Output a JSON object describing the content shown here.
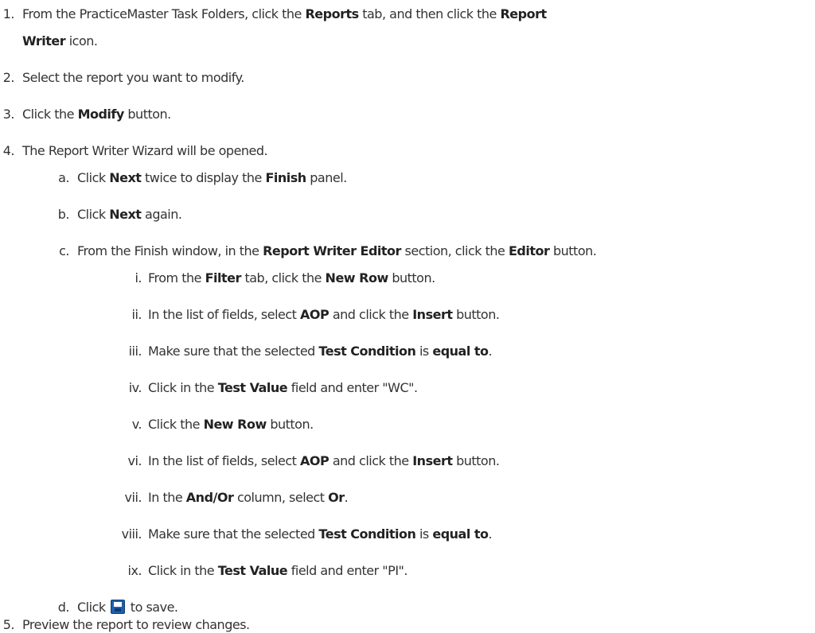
{
  "steps": {
    "s1": {
      "num": "1.",
      "a": "From the PracticeMaster Task Folders, click the ",
      "b1": "Reports",
      "c": " tab, and then click the ",
      "b2": "Report",
      "b3": "Writer",
      "d": " icon."
    },
    "s2": {
      "num": "2.",
      "text": "Select the report you want to modify."
    },
    "s3": {
      "num": "3.",
      "a": "Click the ",
      "b1": "Modify",
      "c": " button."
    },
    "s4": {
      "num": "4.",
      "text": "The Report Writer Wizard will be opened."
    },
    "sa": {
      "num": "a.",
      "a": "Click ",
      "b1": "Next",
      "c": " twice to display the ",
      "b2": "Finish",
      "d": " panel."
    },
    "sb": {
      "num": "b.",
      "a": "Click ",
      "b1": "Next",
      "c": " again."
    },
    "sc": {
      "num": "c.",
      "a": "From the Finish window, in the ",
      "b1": "Report Writer Editor",
      "c": " section, click the ",
      "b2": "Editor",
      "d": " button."
    },
    "si": {
      "num": "i.",
      "a": "From the ",
      "b1": "Filter",
      "c": " tab, click the ",
      "b2": "New Row",
      "d": " button."
    },
    "sii": {
      "num": "ii.",
      "a": "In the list of fields, select ",
      "b1": "AOP",
      "c": " and click the ",
      "b2": "Insert",
      "d": " button."
    },
    "siii": {
      "num": "iii.",
      "a": "Make sure that the selected ",
      "b1": "Test Condition",
      "c": " is ",
      "b2": "equal to",
      "d": "."
    },
    "siv": {
      "num": "iv.",
      "a": "Click in the ",
      "b1": "Test Value",
      "c": " field and enter \"WC\"."
    },
    "sv": {
      "num": "v.",
      "a": "Click the ",
      "b1": "New Row",
      "c": " button."
    },
    "svi": {
      "num": "vi.",
      "a": "In the list of fields, select ",
      "b1": "AOP",
      "c": " and click the ",
      "b2": "Insert",
      "d": " button."
    },
    "svii": {
      "num": "vii.",
      "a": "In the ",
      "b1": "And/Or",
      "c": " column, select ",
      "b2": "Or",
      "d": "."
    },
    "sviii": {
      "num": "viii.",
      "a": "Make sure that the selected ",
      "b1": "Test Condition",
      "c": " is ",
      "b2": "equal to",
      "d": "."
    },
    "six": {
      "num": "ix.",
      "a": "Click in the ",
      "b1": "Test Value",
      "c": " field and enter \"PI\"."
    },
    "sd": {
      "num": "d.",
      "a": "Click",
      "c": " to save.",
      "icon": "save-icon"
    },
    "s5": {
      "num": "5.",
      "text": "Preview the report to review changes."
    }
  }
}
